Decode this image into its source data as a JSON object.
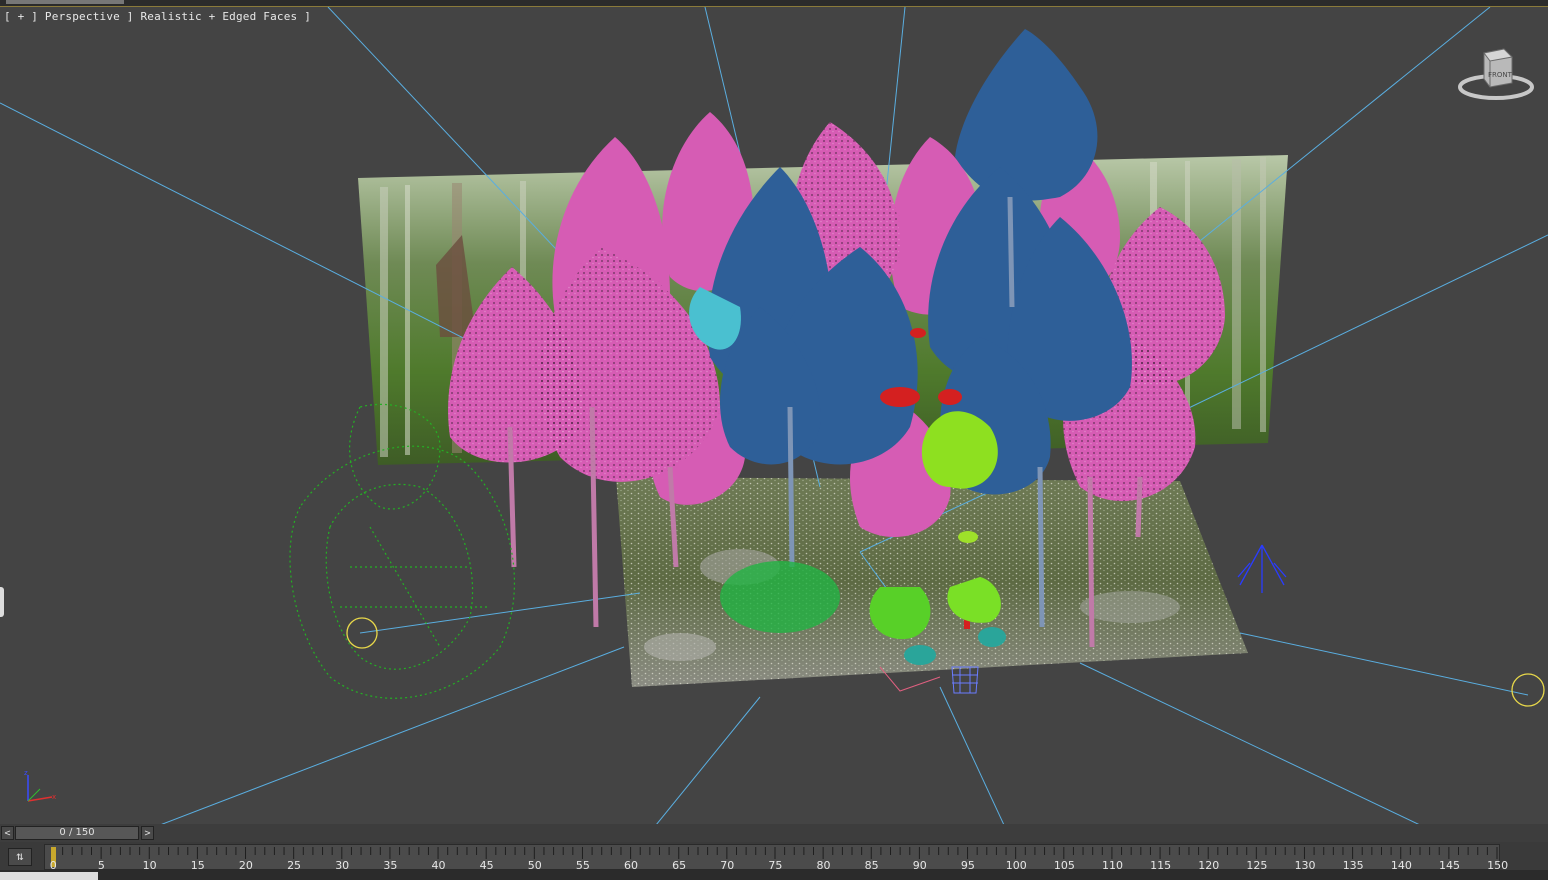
{
  "viewport": {
    "label": "[ + ] Perspective ] Realistic + Edged Faces ]",
    "viewcube_label": "FRONT"
  },
  "colors": {
    "viewport_bg": "#444444",
    "tree_pink": "#d65cb4",
    "tree_blue": "#2e5f98",
    "shrub_green": "#22b422",
    "light_line": "#5aaee0",
    "light_helper": "#e8d84a"
  },
  "timeline": {
    "current_frame": 0,
    "frame_counter": "0 / 150",
    "prev_label": "<",
    "next_label": ">",
    "tick_labels": [
      "0",
      "5",
      "10",
      "15",
      "20",
      "25",
      "30",
      "35",
      "40",
      "45",
      "50",
      "55",
      "60",
      "65",
      "70",
      "75",
      "80",
      "85",
      "90",
      "95",
      "100",
      "105",
      "110",
      "115",
      "120",
      "125",
      "130",
      "135",
      "140",
      "145",
      "150"
    ]
  },
  "icons": {
    "curve_editor": "curve-editor-icon",
    "viewcube": "viewcube-icon",
    "axis": "axis-tripod-icon"
  }
}
